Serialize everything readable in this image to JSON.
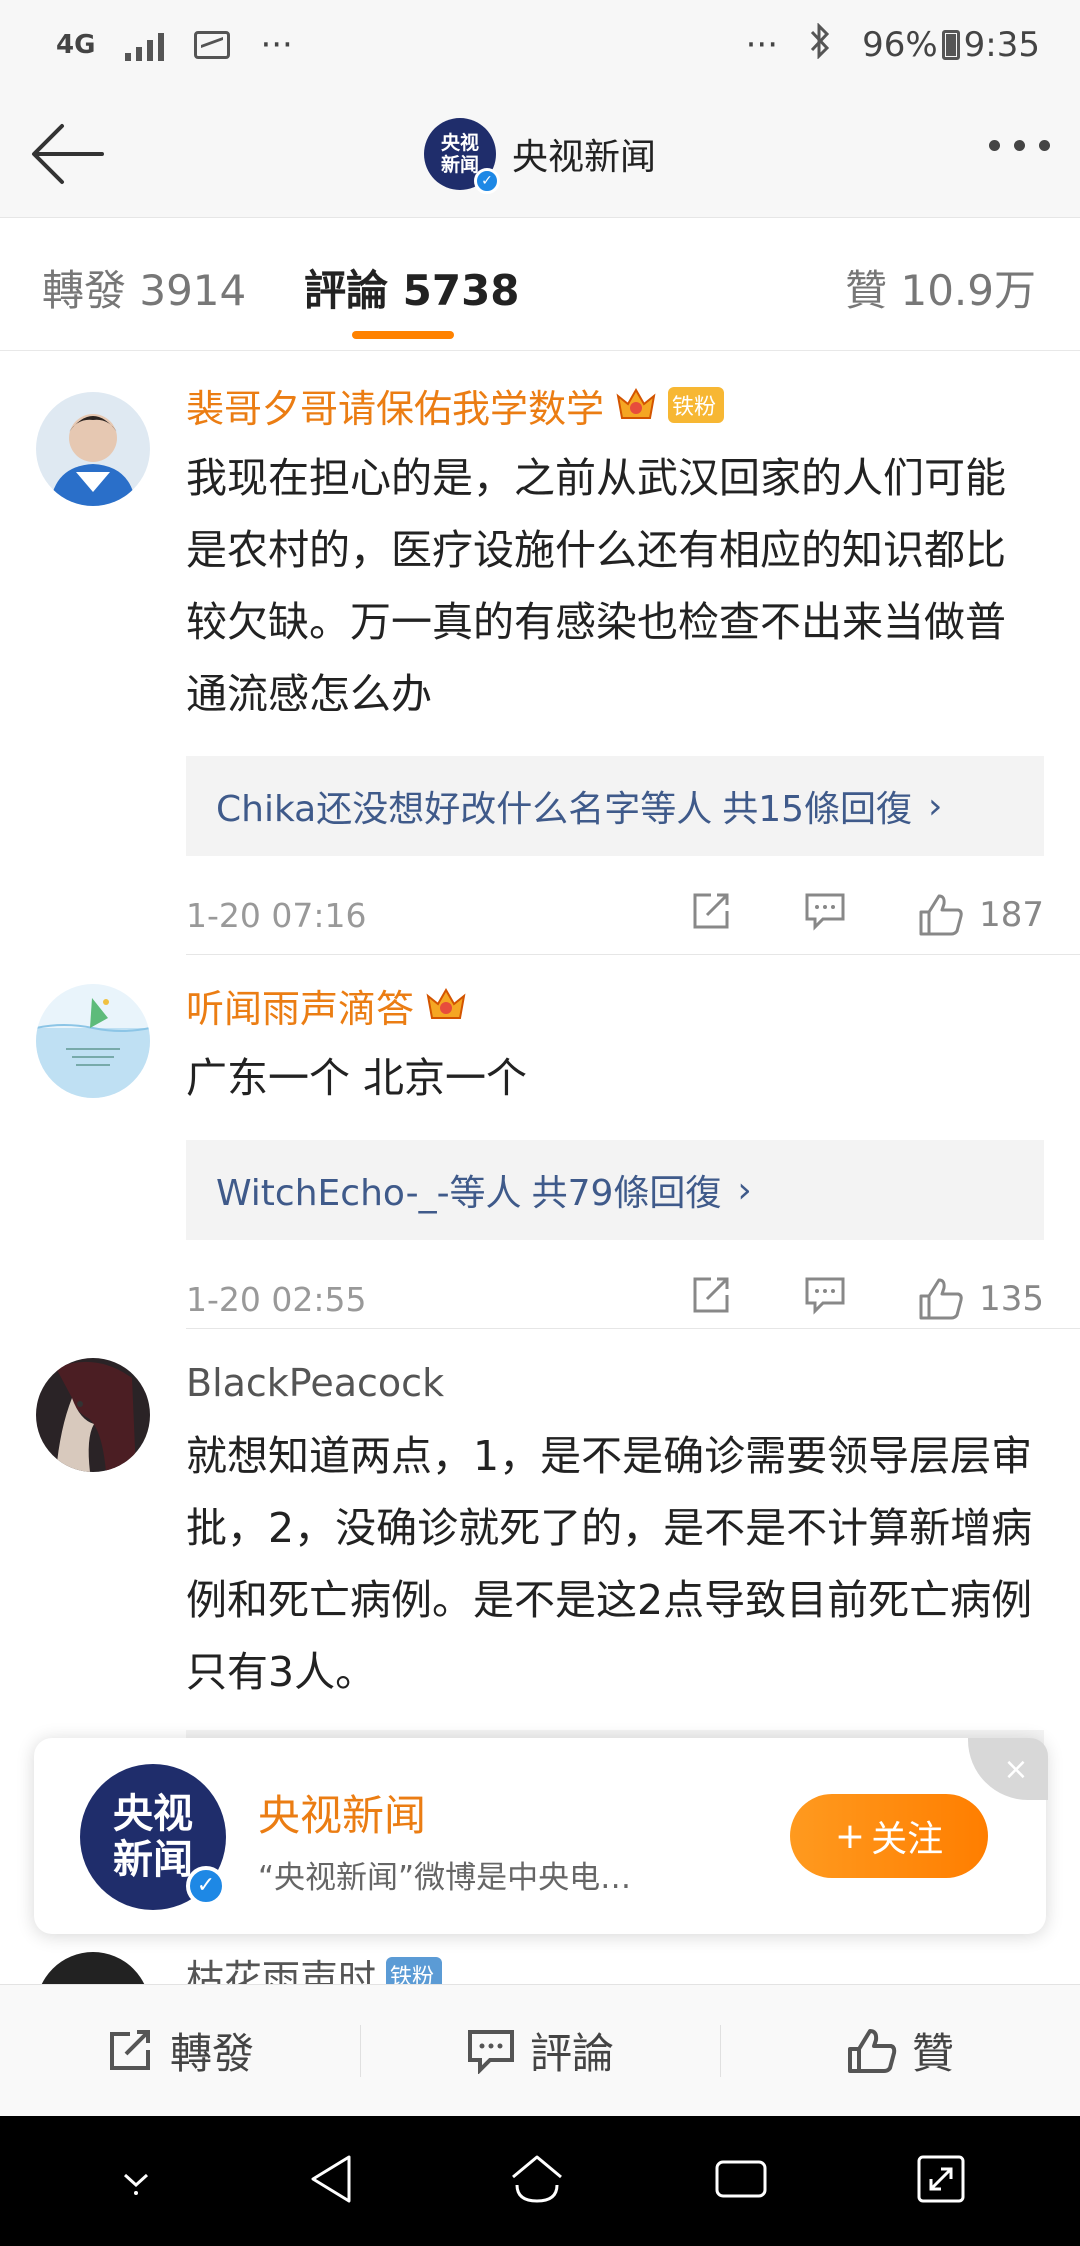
{
  "status_bar": {
    "network": "4G",
    "left_more": "···",
    "right_more": "···",
    "battery": "96%",
    "time": "9:35"
  },
  "nav": {
    "title": "央视新闻",
    "logo_line1": "央视",
    "logo_line2": "新闻"
  },
  "tabs": {
    "repost": "轉發 3914",
    "comment": "評論 5738",
    "like": "贊 10.9万"
  },
  "comments": [
    {
      "name": "裴哥夕哥请保佑我学数学",
      "badge": "铁粉",
      "text": "我现在担心的是，之前从武汉回家的人们可能是农村的，医疗设施什么还有相应的知识都比较欠缺。万一真的有感染也检查不出来当做普通流感怎么办",
      "reply_names": "Chika还没想好改什么名字等人",
      "reply_count": "共15條回復",
      "time": "1-20 07:16",
      "likes": "187"
    },
    {
      "name": "听闻雨声滴答",
      "text": "广东一个 北京一个",
      "reply_names": "WitchEcho-_-等人",
      "reply_count": "共79條回復",
      "time": "1-20 02:55",
      "likes": "135"
    },
    {
      "name": "BlackPeacock",
      "text": "就想知道两点，1，是不是确诊需要领导层层审批，2，没确诊就死了的，是不是不计算新增病例和死亡病例。是不是这2点导致目前死亡病例只有3人。"
    },
    {
      "name": "枯花雨声时",
      "badge": "铁粉"
    }
  ],
  "follow_card": {
    "name": "央视新闻",
    "desc": "“央视新闻”微博是中央电…",
    "follow_label": "关注",
    "close": "×",
    "logo_line1": "央视",
    "logo_line2": "新闻"
  },
  "bottom_bar": {
    "repost": "轉發",
    "comment": "評論",
    "like": "贊"
  },
  "colors": {
    "accent": "#ff8200",
    "username": "#eb7d13",
    "link": "#3f5a8a"
  }
}
